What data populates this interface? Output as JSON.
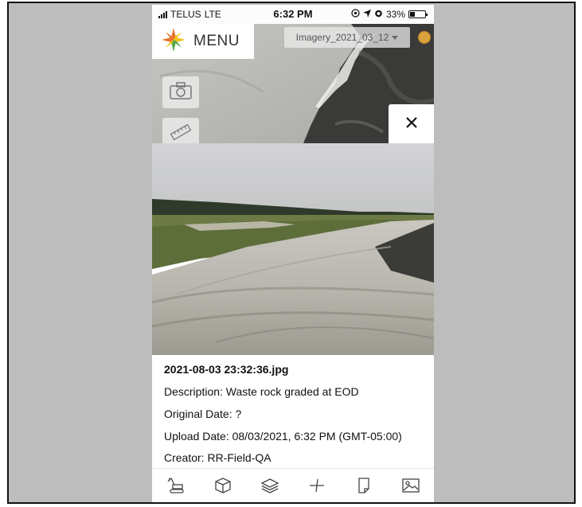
{
  "status_bar": {
    "carrier": "TELUS",
    "network": "LTE",
    "time": "6:32 PM",
    "battery": "33%",
    "battery_level": 0.33
  },
  "map": {
    "menu_label": "MENU",
    "imagery_layer": "Imagery_2021_03_12",
    "tools": [
      "camera-icon",
      "ruler-icon"
    ]
  },
  "photo_viewer": {
    "filename": "2021-08-03 23:32:36.jpg",
    "description": "Description: Waste rock graded at EOD",
    "original_date": "Original Date: ?",
    "upload_date": "Upload Date: 08/03/2021, 6:32 PM (GMT-05:00)",
    "creator": "Creator: RR-Field-QA"
  },
  "toolbar": {
    "icons": [
      "excavator-icon",
      "cube-icon",
      "layers-icon",
      "crosshair-icon",
      "document-icon",
      "image-icon"
    ]
  },
  "colors": {
    "frame_background": "#bdbdbd",
    "logo_orange": "#e8732a",
    "logo_yellow": "#f2c21b",
    "logo_green": "#5aa64a",
    "user_dot": "#d9a13b"
  }
}
